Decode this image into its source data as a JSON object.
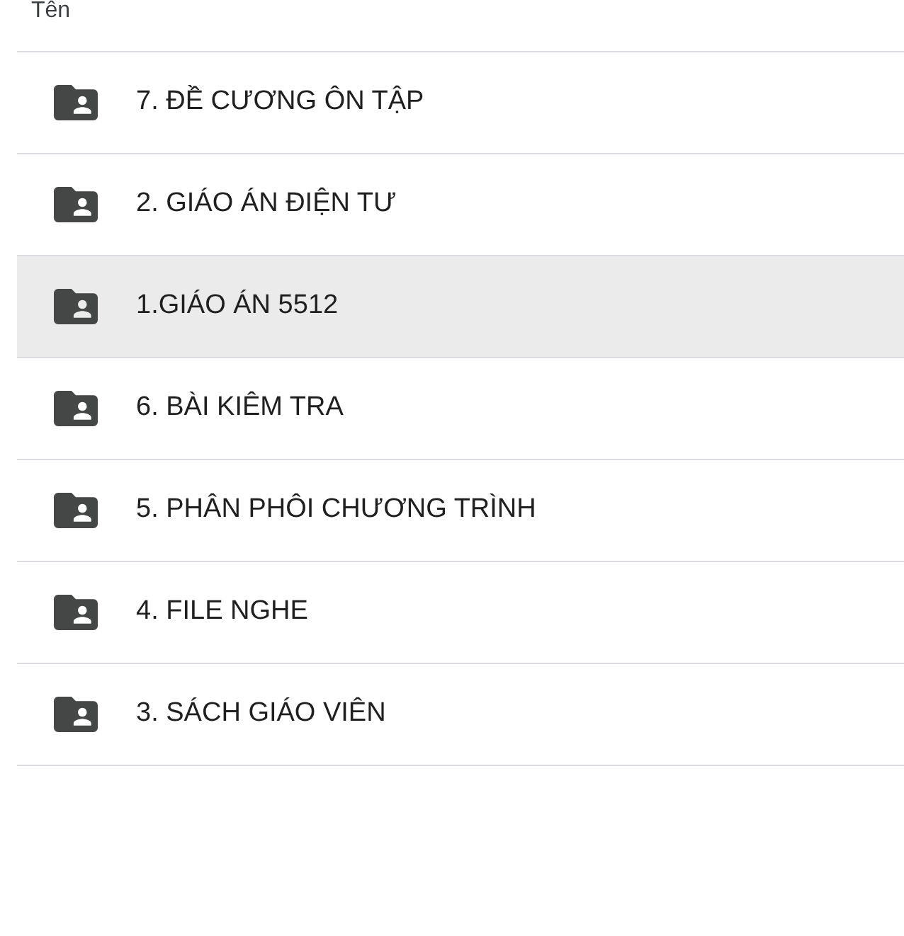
{
  "table": {
    "columns": [
      {
        "label": "Tên"
      }
    ],
    "rows": [
      {
        "name": "7. ĐỀ CƯƠNG ÔN TẬP",
        "selected": false
      },
      {
        "name": "2. GIÁO ÁN ĐIỆN TƯ",
        "selected": false
      },
      {
        "name": "1.GIÁO ÁN 5512",
        "selected": true
      },
      {
        "name": "6. BÀI KIÊM TRA",
        "selected": false
      },
      {
        "name": "5. PHÂN PHÔI CHƯƠNG TRÌNH",
        "selected": false
      },
      {
        "name": "4. FILE NGHE",
        "selected": false
      },
      {
        "name": "3. SÁCH GIÁO VIÊN",
        "selected": false
      }
    ]
  }
}
